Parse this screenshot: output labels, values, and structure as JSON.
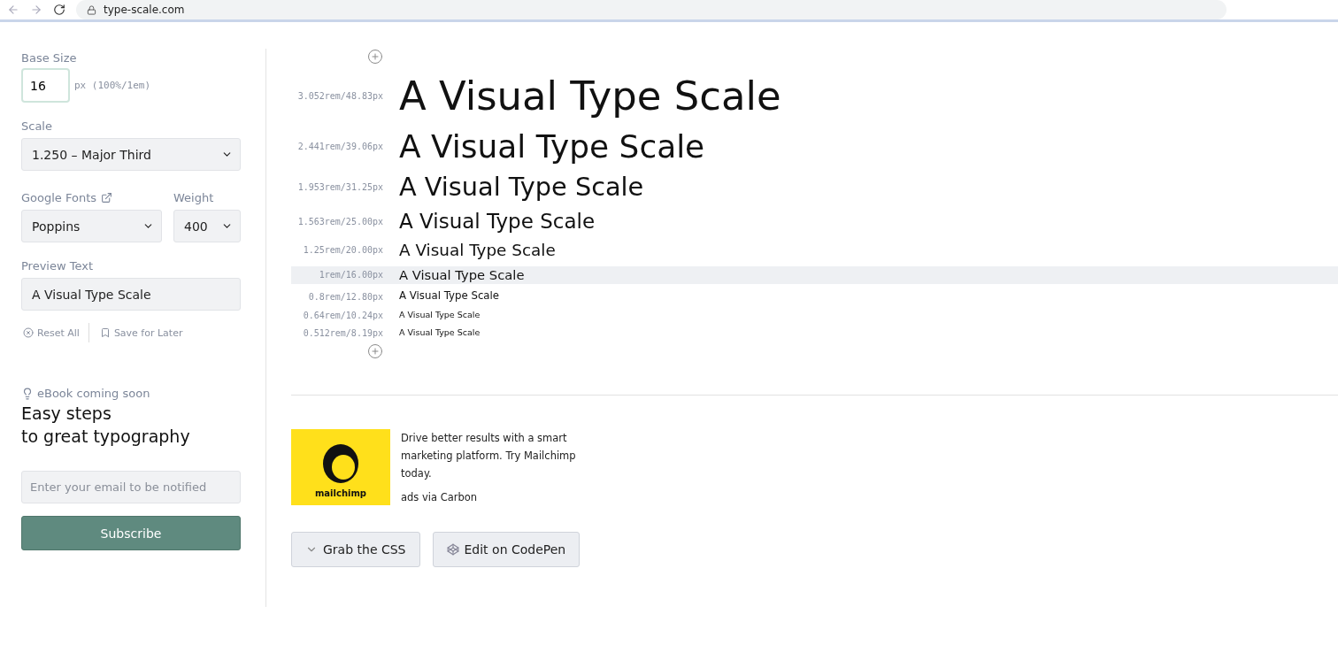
{
  "browser": {
    "url": "type-scale.com"
  },
  "sidebar": {
    "base_size": {
      "label": "Base Size",
      "value": "16",
      "unit": "px (100%/1em)"
    },
    "scale": {
      "label": "Scale",
      "value": "1.250 – Major Third"
    },
    "font": {
      "label": "Google Fonts",
      "value": "Poppins"
    },
    "weight": {
      "label": "Weight",
      "value": "400"
    },
    "preview": {
      "label": "Preview Text",
      "value": "A Visual Type Scale"
    },
    "actions": [
      {
        "label": "Reset All",
        "kind": "reset"
      },
      {
        "label": "Save for Later",
        "kind": "save"
      }
    ],
    "ebook": {
      "tag": "eBook coming soon",
      "heading": [
        "Easy steps",
        "to great typography"
      ]
    },
    "email": {
      "placeholder": "Enter your email to be notified"
    },
    "subscribe": "Subscribe"
  },
  "scale_rows": [
    {
      "size": "3.052rem/48.83px",
      "preview": "A Visual Type Scale",
      "selected": false
    },
    {
      "size": "2.441rem/39.06px",
      "preview": "A Visual Type Scale",
      "selected": false
    },
    {
      "size": "1.953rem/31.25px",
      "preview": "A Visual Type Scale",
      "selected": false
    },
    {
      "size": "1.563rem/25.00px",
      "preview": "A Visual Type Scale",
      "selected": false
    },
    {
      "size": "1.25rem/20.00px",
      "preview": "A Visual Type Scale",
      "selected": false
    },
    {
      "size": "1rem/16.00px",
      "preview": "A Visual Type Scale",
      "selected": true
    },
    {
      "size": "0.8rem/12.80px",
      "preview": "A Visual Type Scale",
      "selected": false
    },
    {
      "size": "0.64rem/10.24px",
      "preview": "A Visual Type Scale",
      "selected": false
    },
    {
      "size": "0.512rem/8.19px",
      "preview": "A Visual Type Scale",
      "selected": false
    }
  ],
  "ad": {
    "image_text": "mailchimp",
    "text": "Drive better results with a smart marketing platform. Try Mailchimp today.",
    "via": "ads via Carbon"
  },
  "buttons": [
    {
      "label": "Grab the CSS",
      "kind": "grab"
    },
    {
      "label": "Edit on CodePen",
      "kind": "codepen"
    }
  ]
}
